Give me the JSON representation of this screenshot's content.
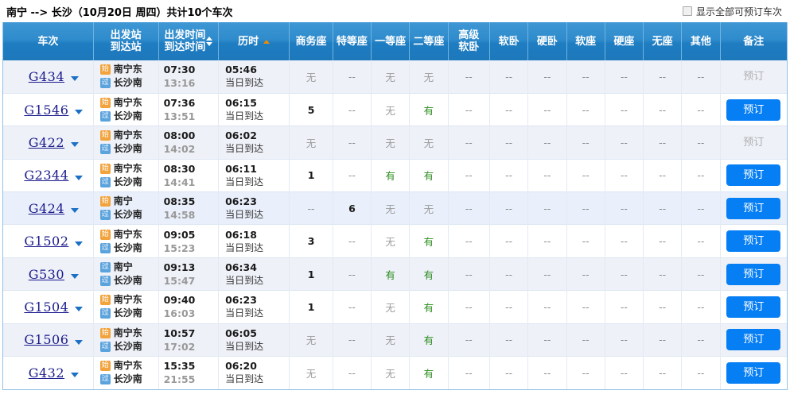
{
  "header": {
    "route": "南宁 --> 长沙（10月20日  周四）",
    "count_text": "共计10个车次",
    "show_all_label": "显示全部可预订车次",
    "show_all_checked": false
  },
  "columns": {
    "train_no": "车次",
    "from_station": "出发站",
    "to_station": "到达站",
    "depart_time": "出发时间",
    "arrive_time": "到达时间",
    "duration": "历时",
    "business": "商务座",
    "special": "特等座",
    "first": "一等座",
    "second": "二等座",
    "premium_soft_sleeper_1": "高级",
    "premium_soft_sleeper_2": "软卧",
    "soft_sleeper": "软卧",
    "hard_sleeper": "硬卧",
    "soft_seat": "软座",
    "hard_seat": "硬座",
    "no_seat": "无座",
    "other": "其他",
    "remark": "备注"
  },
  "sort": {
    "time_asc_active": false,
    "time_desc_active": false,
    "duration_asc_active": true
  },
  "badges": {
    "start": "始",
    "pass": "过"
  },
  "labels": {
    "book": "预订",
    "same_day": "当日到达",
    "none": "无",
    "available": "有",
    "na": "--"
  },
  "rows": [
    {
      "code": "G434",
      "from_badge": "start",
      "from": "南宁东",
      "to_badge": "pass",
      "to": "长沙南",
      "depart": "07:30",
      "arrive": "13:16",
      "duration": "05:46",
      "arrive_day": "当日到达",
      "seats": [
        "无",
        "--",
        "无",
        "无",
        "--",
        "--",
        "--",
        "--",
        "--",
        "--",
        "--"
      ],
      "bookable": false,
      "stripe": true,
      "hover": false
    },
    {
      "code": "G1546",
      "from_badge": "start",
      "from": "南宁东",
      "to_badge": "pass",
      "to": "长沙南",
      "depart": "07:36",
      "arrive": "13:51",
      "duration": "06:15",
      "arrive_day": "当日到达",
      "seats": [
        "5",
        "--",
        "无",
        "有",
        "--",
        "--",
        "--",
        "--",
        "--",
        "--",
        "--"
      ],
      "bookable": true,
      "stripe": false,
      "hover": false
    },
    {
      "code": "G422",
      "from_badge": "start",
      "from": "南宁东",
      "to_badge": "pass",
      "to": "长沙南",
      "depart": "08:00",
      "arrive": "14:02",
      "duration": "06:02",
      "arrive_day": "当日到达",
      "seats": [
        "无",
        "--",
        "无",
        "无",
        "--",
        "--",
        "--",
        "--",
        "--",
        "--",
        "--"
      ],
      "bookable": false,
      "stripe": true,
      "hover": false
    },
    {
      "code": "G2344",
      "from_badge": "start",
      "from": "南宁东",
      "to_badge": "pass",
      "to": "长沙南",
      "depart": "08:30",
      "arrive": "14:41",
      "duration": "06:11",
      "arrive_day": "当日到达",
      "seats": [
        "1",
        "--",
        "有",
        "有",
        "--",
        "--",
        "--",
        "--",
        "--",
        "--",
        "--"
      ],
      "bookable": true,
      "stripe": false,
      "hover": false
    },
    {
      "code": "G424",
      "from_badge": "start",
      "from": "南宁",
      "to_badge": "pass",
      "to": "长沙南",
      "depart": "08:35",
      "arrive": "14:58",
      "duration": "06:23",
      "arrive_day": "当日到达",
      "seats": [
        "--",
        "6",
        "无",
        "无",
        "--",
        "--",
        "--",
        "--",
        "--",
        "--",
        "--"
      ],
      "bookable": true,
      "stripe": true,
      "hover": true
    },
    {
      "code": "G1502",
      "from_badge": "start",
      "from": "南宁东",
      "to_badge": "pass",
      "to": "长沙南",
      "depart": "09:05",
      "arrive": "15:23",
      "duration": "06:18",
      "arrive_day": "当日到达",
      "seats": [
        "3",
        "--",
        "无",
        "有",
        "--",
        "--",
        "--",
        "--",
        "--",
        "--",
        "--"
      ],
      "bookable": true,
      "stripe": false,
      "hover": false
    },
    {
      "code": "G530",
      "from_badge": "pass",
      "from": "南宁",
      "to_badge": "pass",
      "to": "长沙南",
      "depart": "09:13",
      "arrive": "15:47",
      "duration": "06:34",
      "arrive_day": "当日到达",
      "seats": [
        "1",
        "--",
        "有",
        "有",
        "--",
        "--",
        "--",
        "--",
        "--",
        "--",
        "--"
      ],
      "bookable": true,
      "stripe": true,
      "hover": false
    },
    {
      "code": "G1504",
      "from_badge": "start",
      "from": "南宁东",
      "to_badge": "pass",
      "to": "长沙南",
      "depart": "09:40",
      "arrive": "16:03",
      "duration": "06:23",
      "arrive_day": "当日到达",
      "seats": [
        "1",
        "--",
        "无",
        "有",
        "--",
        "--",
        "--",
        "--",
        "--",
        "--",
        "--"
      ],
      "bookable": true,
      "stripe": false,
      "hover": false
    },
    {
      "code": "G1506",
      "from_badge": "start",
      "from": "南宁东",
      "to_badge": "pass",
      "to": "长沙南",
      "depart": "10:57",
      "arrive": "17:02",
      "duration": "06:05",
      "arrive_day": "当日到达",
      "seats": [
        "无",
        "--",
        "无",
        "有",
        "--",
        "--",
        "--",
        "--",
        "--",
        "--",
        "--"
      ],
      "bookable": true,
      "stripe": true,
      "hover": false
    },
    {
      "code": "G432",
      "from_badge": "start",
      "from": "南宁东",
      "to_badge": "pass",
      "to": "长沙南",
      "depart": "15:35",
      "arrive": "21:55",
      "duration": "06:20",
      "arrive_day": "当日到达",
      "seats": [
        "无",
        "--",
        "无",
        "有",
        "--",
        "--",
        "--",
        "--",
        "--",
        "--",
        "--"
      ],
      "bookable": true,
      "stripe": false,
      "hover": false
    }
  ]
}
